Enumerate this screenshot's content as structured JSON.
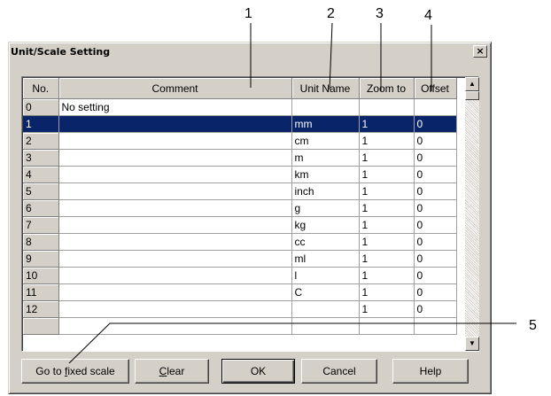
{
  "callouts": [
    "1",
    "2",
    "3",
    "4",
    "5"
  ],
  "dialog": {
    "title": "Unit/Scale Setting",
    "close_glyph": "×"
  },
  "grid": {
    "columns": [
      "No.",
      "Comment",
      "Unit Name",
      "Zoom to",
      "Offset"
    ],
    "rows": [
      {
        "no": "0",
        "comment": "No setting",
        "unit": "",
        "zoom": "",
        "offset": ""
      },
      {
        "no": "1",
        "comment": "",
        "unit": "mm",
        "zoom": "1",
        "offset": "0"
      },
      {
        "no": "2",
        "comment": "",
        "unit": "cm",
        "zoom": "1",
        "offset": "0"
      },
      {
        "no": "3",
        "comment": "",
        "unit": "m",
        "zoom": "1",
        "offset": "0"
      },
      {
        "no": "4",
        "comment": "",
        "unit": "km",
        "zoom": "1",
        "offset": "0"
      },
      {
        "no": "5",
        "comment": "",
        "unit": "inch",
        "zoom": "1",
        "offset": "0"
      },
      {
        "no": "6",
        "comment": "",
        "unit": "g",
        "zoom": "1",
        "offset": "0"
      },
      {
        "no": "7",
        "comment": "",
        "unit": "kg",
        "zoom": "1",
        "offset": "0"
      },
      {
        "no": "8",
        "comment": "",
        "unit": "cc",
        "zoom": "1",
        "offset": "0"
      },
      {
        "no": "9",
        "comment": "",
        "unit": "ml",
        "zoom": "1",
        "offset": "0"
      },
      {
        "no": "10",
        "comment": "",
        "unit": "l",
        "zoom": "1",
        "offset": "0"
      },
      {
        "no": "11",
        "comment": "",
        "unit": "C",
        "zoom": "1",
        "offset": "0"
      },
      {
        "no": "12",
        "comment": "",
        "unit": "",
        "zoom": "1",
        "offset": "0"
      }
    ],
    "selected_row": "1"
  },
  "scrollbar": {
    "up_glyph": "▲",
    "down_glyph": "▼"
  },
  "buttons": {
    "fixed_scale": {
      "pre": "Go to ",
      "mnemonic": "f",
      "post": "ixed scale"
    },
    "clear": {
      "pre": "",
      "mnemonic": "C",
      "post": "lear"
    },
    "ok": "OK",
    "cancel": "Cancel",
    "help": "Help"
  },
  "colors": {
    "selection": "#0a246a",
    "face": "#d4d0c8"
  }
}
